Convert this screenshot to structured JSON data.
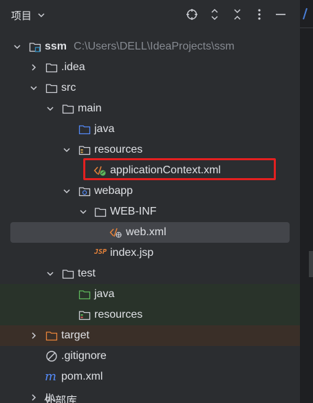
{
  "header": {
    "title": "项目",
    "icons": [
      "chevron-down-icon",
      "locate-icon",
      "expand-collapse-icon",
      "collapse-all-icon",
      "more-options-icon",
      "minimize-icon"
    ]
  },
  "tree": {
    "root_name": "ssm",
    "root_path": "C:\\Users\\DELL\\IdeaProjects\\ssm",
    "idea": ".idea",
    "src": "src",
    "main": "main",
    "java": "java",
    "resources": "resources",
    "applicationContext": "applicationContext.xml",
    "webapp": "webapp",
    "webinf": "WEB-INF",
    "webxml": "web.xml",
    "indexjsp": "index.jsp",
    "test": "test",
    "test_java": "java",
    "test_resources": "resources",
    "target": "target",
    "gitignore": ".gitignore",
    "pom": "pom.xml",
    "external_libs": "外部库"
  },
  "colors": {
    "background": "#2b2d30",
    "selected": "#43454a",
    "test_bg": "#29332a",
    "excluded_bg": "#3a2f28",
    "highlight": "#e32020"
  }
}
